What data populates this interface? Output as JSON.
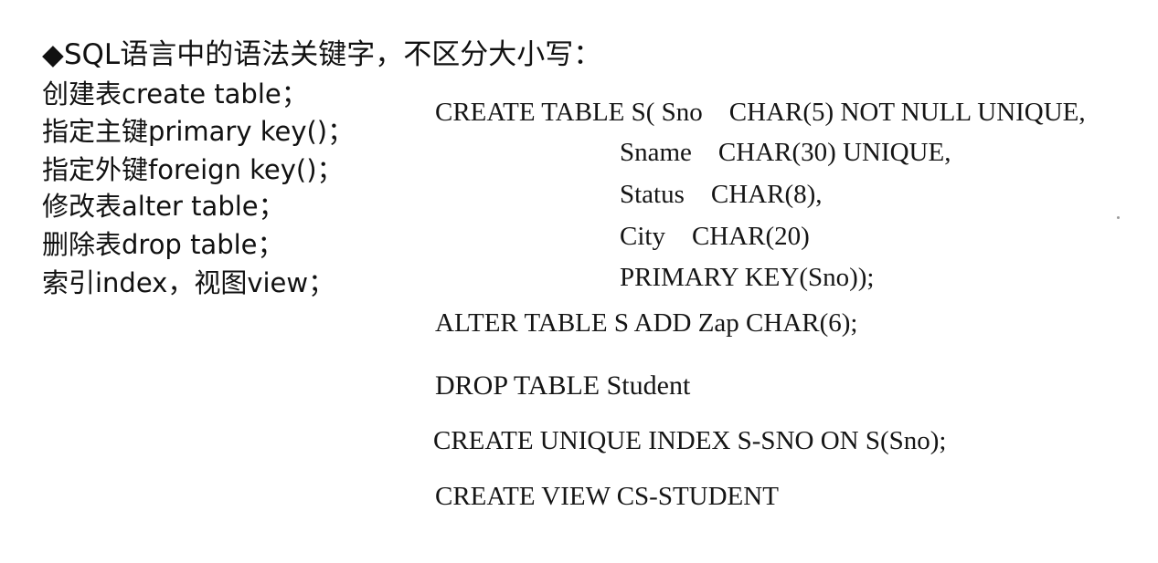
{
  "heading": "◆SQL语言中的语法关键字，不区分大小写：",
  "keywords": [
    "创建表create table；",
    "指定主键primary key()；",
    "指定外键foreign key()；",
    "修改表alter table；",
    "删除表drop table；",
    "索引index，视图view；"
  ],
  "sql": {
    "create_table": [
      "CREATE TABLE S( Sno    CHAR(5) NOT NULL UNIQUE,",
      "Sname    CHAR(30) UNIQUE,",
      "Status    CHAR(8),",
      "City    CHAR(20)",
      "PRIMARY KEY(Sno));"
    ],
    "alter": "ALTER TABLE S ADD Zap CHAR(6);",
    "drop": "DROP TABLE Student",
    "create_index": "CREATE UNIQUE INDEX S-SNO ON S(Sno);",
    "create_view": "CREATE VIEW CS-STUDENT"
  }
}
